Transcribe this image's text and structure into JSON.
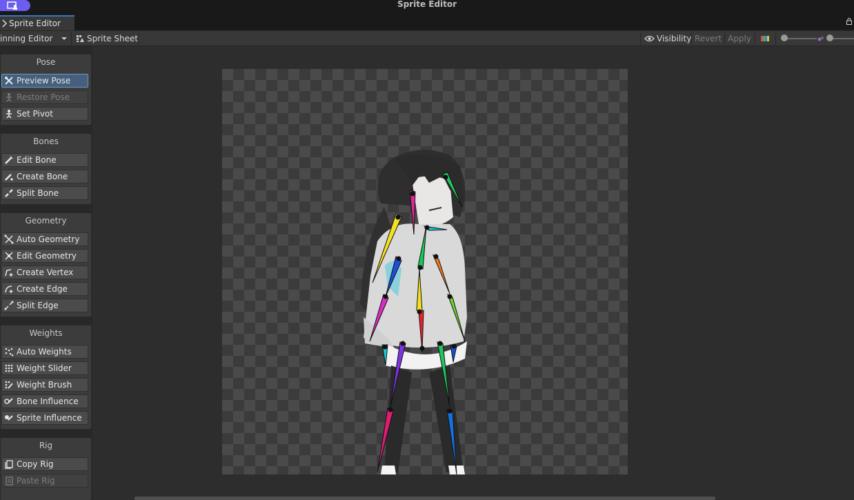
{
  "window": {
    "title": "Sprite Editor"
  },
  "tab": {
    "label": "Sprite Editor"
  },
  "toolbar": {
    "mode_label": "inning Editor",
    "sprite_sheet_label": "Sprite Sheet",
    "visibility_label": "Visibility",
    "revert_label": "Revert",
    "apply_label": "Apply"
  },
  "panels": {
    "pose": {
      "title": "Pose",
      "buttons": [
        "Preview Pose",
        "Restore Pose",
        "Set Pivot"
      ]
    },
    "bones": {
      "title": "Bones",
      "buttons": [
        "Edit Bone",
        "Create Bone",
        "Split Bone"
      ]
    },
    "geometry": {
      "title": "Geometry",
      "buttons": [
        "Auto Geometry",
        "Edit Geometry",
        "Create Vertex",
        "Create Edge",
        "Split Edge"
      ]
    },
    "weights": {
      "title": "Weights",
      "buttons": [
        "Auto Weights",
        "Weight Slider",
        "Weight Brush",
        "Bone Influence",
        "Sprite Influence"
      ]
    },
    "rig": {
      "title": "Rig",
      "buttons": [
        "Copy Rig",
        "Paste Rig"
      ]
    }
  },
  "colors": {
    "accent": "#3a79bb",
    "active_button": "#46607c",
    "title_badge": "#6c5cf0"
  }
}
